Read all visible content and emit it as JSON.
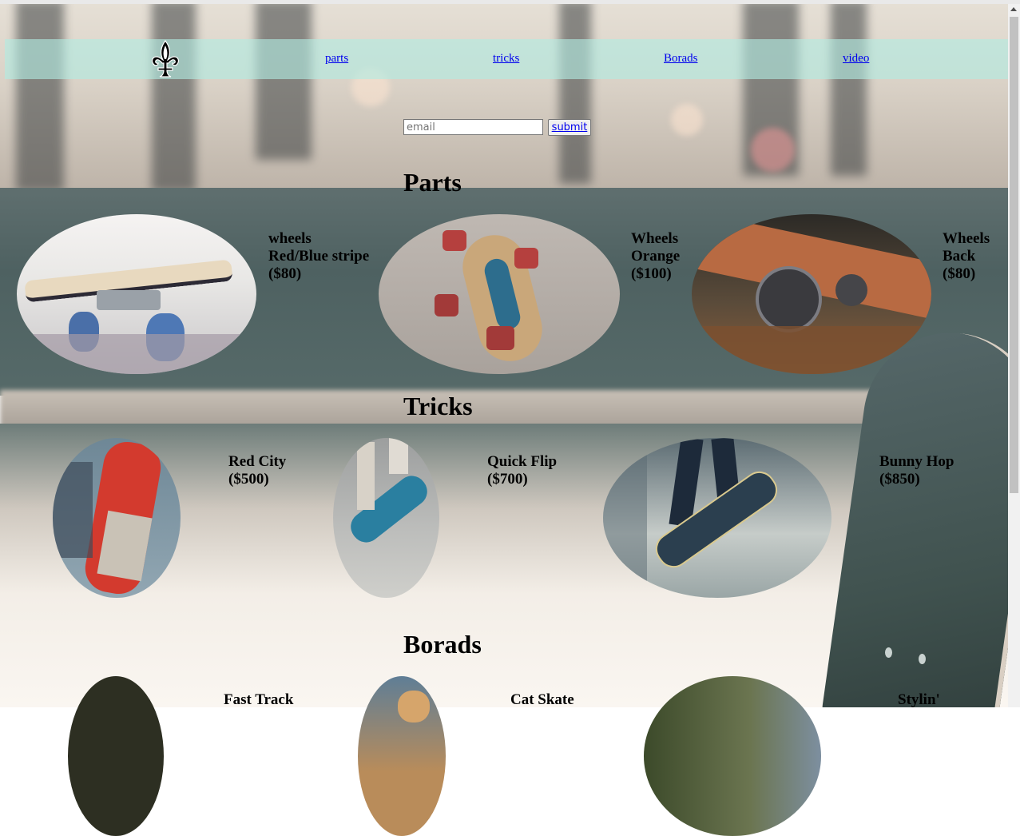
{
  "nav": {
    "links": [
      "parts",
      "tricks",
      "Borads",
      "video"
    ]
  },
  "signup": {
    "email_placeholder": "email",
    "submit_label": "submit"
  },
  "sections": {
    "parts": {
      "heading": "Parts",
      "items": [
        {
          "lines": [
            "wheels",
            "Red/Blue stripe",
            "($80)"
          ]
        },
        {
          "lines": [
            "Wheels",
            "Orange",
            "($100)"
          ]
        },
        {
          "lines": [
            "Wheels",
            "Back",
            "($80)"
          ]
        }
      ]
    },
    "tricks": {
      "heading": "Tricks",
      "items": [
        {
          "lines": [
            "Red City",
            "($500)"
          ]
        },
        {
          "lines": [
            "Quick Flip",
            "($700)"
          ]
        },
        {
          "lines": [
            "Bunny Hop",
            "($850)"
          ]
        }
      ]
    },
    "boards": {
      "heading": "Borads",
      "items": [
        {
          "lines": [
            "Fast Track"
          ]
        },
        {
          "lines": [
            "Cat Skate"
          ]
        },
        {
          "lines": [
            "Stylin'"
          ]
        }
      ]
    }
  },
  "colors": {
    "nav_bg": "#b2ebe2",
    "link": "#0000ee"
  }
}
